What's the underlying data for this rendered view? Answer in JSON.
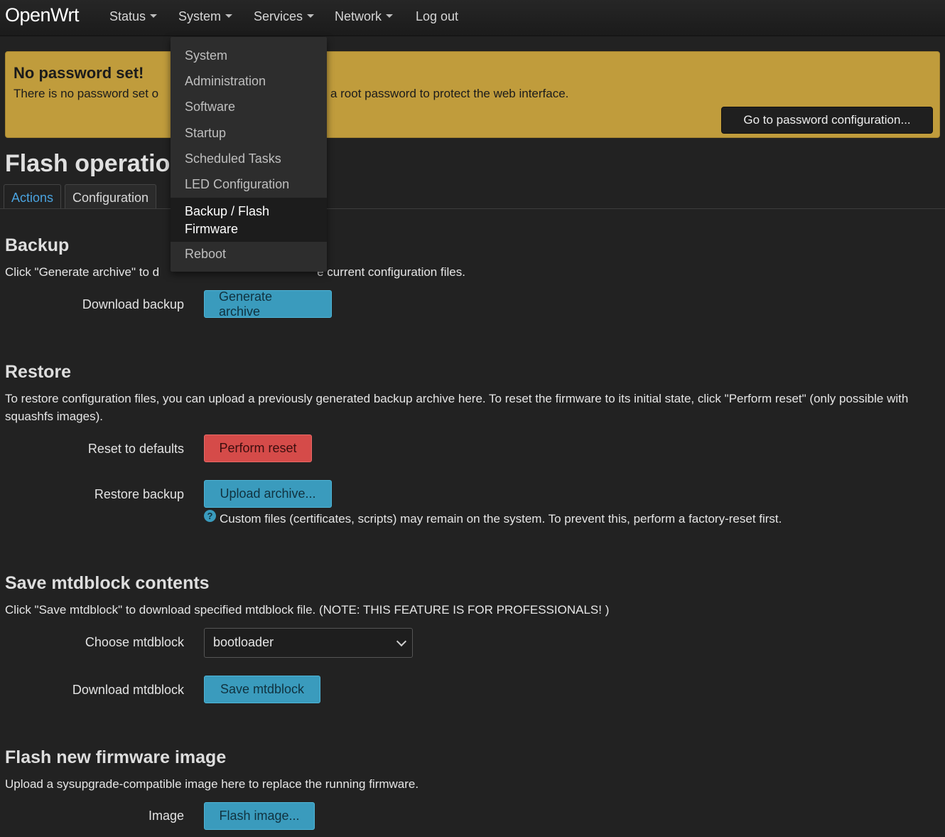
{
  "navbar": {
    "brand": "OpenWrt",
    "items": [
      {
        "label": "Status",
        "has_caret": true
      },
      {
        "label": "System",
        "has_caret": true
      },
      {
        "label": "Services",
        "has_caret": true
      },
      {
        "label": "Network",
        "has_caret": true
      },
      {
        "label": "Log out",
        "has_caret": false
      }
    ]
  },
  "system_menu": {
    "items": [
      {
        "label": "System"
      },
      {
        "label": "Administration"
      },
      {
        "label": "Software"
      },
      {
        "label": "Startup"
      },
      {
        "label": "Scheduled Tasks"
      },
      {
        "label": "LED Configuration"
      },
      {
        "label_line1": "Backup / Flash",
        "label_line2": "Firmware",
        "active": true
      },
      {
        "label": "Reboot"
      }
    ]
  },
  "alert": {
    "title": "No password set!",
    "text_before": "There is no password set o",
    "text_after": "re a root password to protect the web interface.",
    "button": "Go to password configuration..."
  },
  "page": {
    "title": "Flash operatio",
    "tabs": [
      {
        "label": "Actions",
        "active": true
      },
      {
        "label": "Configuration",
        "active": false
      }
    ]
  },
  "backup": {
    "title": "Backup",
    "desc_before": "Click \"Generate archive\" to d",
    "desc_after": "e current configuration files.",
    "download_label": "Download backup",
    "generate_button": "Generate archive"
  },
  "restore": {
    "title": "Restore",
    "desc": "To restore configuration files, you can upload a previously generated backup archive here. To reset the firmware to its initial state, click \"Perform reset\" (only possible with squashfs images).",
    "reset_label": "Reset to defaults",
    "reset_button": "Perform reset",
    "restore_label": "Restore backup",
    "upload_button": "Upload archive...",
    "help_icon": "?",
    "help_text": "Custom files (certificates, scripts) may remain on the system. To prevent this, perform a factory-reset first."
  },
  "mtdblock": {
    "title": "Save mtdblock contents",
    "desc": "Click \"Save mtdblock\" to download specified mtdblock file. (NOTE: THIS FEATURE IS FOR PROFESSIONALS! )",
    "choose_label": "Choose mtdblock",
    "selected": "bootloader",
    "download_label": "Download mtdblock",
    "save_button": "Save mtdblock"
  },
  "flash": {
    "title": "Flash new firmware image",
    "desc": "Upload a sysupgrade-compatible image here to replace the running firmware.",
    "image_label": "Image",
    "flash_button": "Flash image..."
  },
  "colors": {
    "background": "#222222",
    "alert": "#c09c3c",
    "primary_button": "#3a9bbd",
    "danger_button": "#d54b49",
    "active_tab": "#4aa3df"
  }
}
